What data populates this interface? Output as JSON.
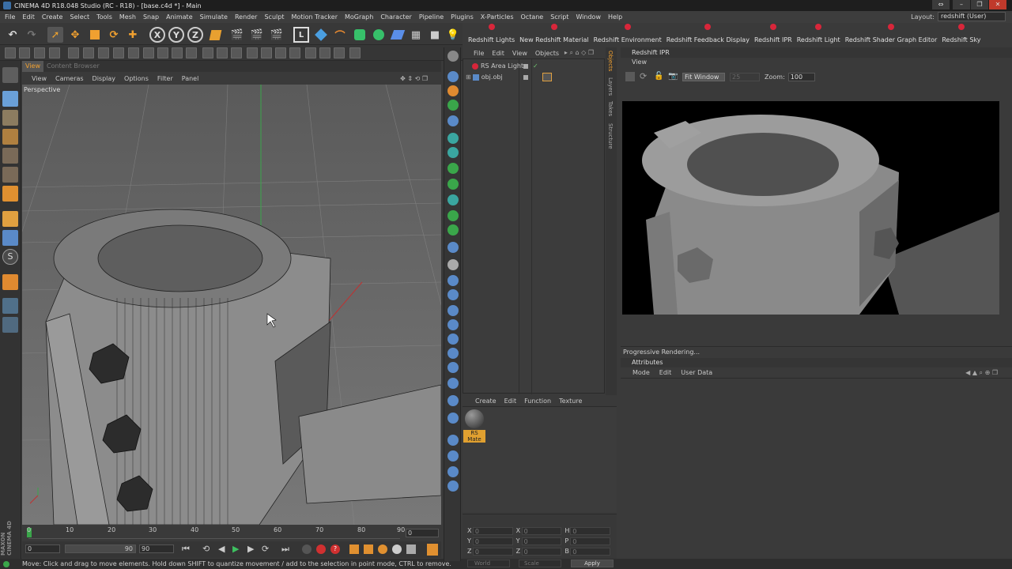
{
  "window": {
    "title": "CINEMA 4D R18.048 Studio (RC - R18) - [base.c4d *] - Main",
    "controls": [
      "⇔",
      "–",
      "❐",
      "✕"
    ]
  },
  "menubar": {
    "items": [
      "File",
      "Edit",
      "Create",
      "Select",
      "Tools",
      "Mesh",
      "Snap",
      "Animate",
      "Simulate",
      "Render",
      "Sculpt",
      "Motion Tracker",
      "MoGraph",
      "Character",
      "Pipeline",
      "Plugins",
      "X-Particles",
      "Octane",
      "Script",
      "Window",
      "Help"
    ],
    "layout_label": "Layout:",
    "layout_value": "redshift (User)"
  },
  "toolbar": {
    "axis_x": "X",
    "axis_y": "Y",
    "axis_z": "Z"
  },
  "redshift_bar": {
    "buttons": [
      "Redshift Lights",
      "New Redshift Material",
      "Redshift Environment",
      "Redshift Feedback Display",
      "Redshift IPR",
      "Redshift Light",
      "Redshift Shader Graph Editor",
      "Redshift Sky"
    ],
    "accent": "#d8263a"
  },
  "viewport": {
    "tabs": [
      "View",
      "Content Browser"
    ],
    "menu": [
      "View",
      "Cameras",
      "Display",
      "Options",
      "Filter",
      "Panel"
    ],
    "label": "Perspective"
  },
  "timeline": {
    "ticks": [
      "0",
      "10",
      "20",
      "30",
      "40",
      "50",
      "60",
      "70",
      "80",
      "90"
    ],
    "current_frame": "0",
    "start_field": "0",
    "min_field": "0",
    "max_field": "90",
    "end_field": "90"
  },
  "status": {
    "text": "Move: Click and drag to move elements. Hold down SHIFT to quantize movement / add to the selection in point mode, CTRL to remove."
  },
  "object_manager": {
    "menu": [
      "File",
      "Edit",
      "View",
      "Objects"
    ],
    "objects": [
      {
        "name": "RS Area Light"
      },
      {
        "name": "obj.obj"
      }
    ],
    "side_tabs": [
      "Objects",
      "Layers",
      "Takes",
      "Structure"
    ]
  },
  "material_manager": {
    "menu": [
      "Create",
      "Edit",
      "Function",
      "Texture"
    ],
    "materials": [
      {
        "name": "RS Mate"
      }
    ]
  },
  "coordinates": {
    "rows": [
      {
        "a": "X",
        "av": "0",
        "b": "X",
        "bv": "0",
        "c": "H",
        "cv": "0"
      },
      {
        "a": "Y",
        "av": "0",
        "b": "Y",
        "bv": "0",
        "c": "P",
        "cv": "0"
      },
      {
        "a": "Z",
        "av": "0",
        "b": "Z",
        "bv": "0",
        "c": "B",
        "cv": "0"
      }
    ],
    "mode1": "World",
    "mode2": "Scale",
    "apply": "Apply"
  },
  "ipr": {
    "title": "Redshift IPR",
    "menu": "View",
    "fit_label": "Fit Window",
    "quality": "25",
    "zoom_label": "Zoom:",
    "zoom_value": "100",
    "status": "Progressive Rendering..."
  },
  "attributes": {
    "title": "Attributes",
    "menu": [
      "Mode",
      "Edit",
      "User Data"
    ]
  },
  "logo": {
    "maxon": "MAXON",
    "c4d": "CINEMA 4D"
  }
}
